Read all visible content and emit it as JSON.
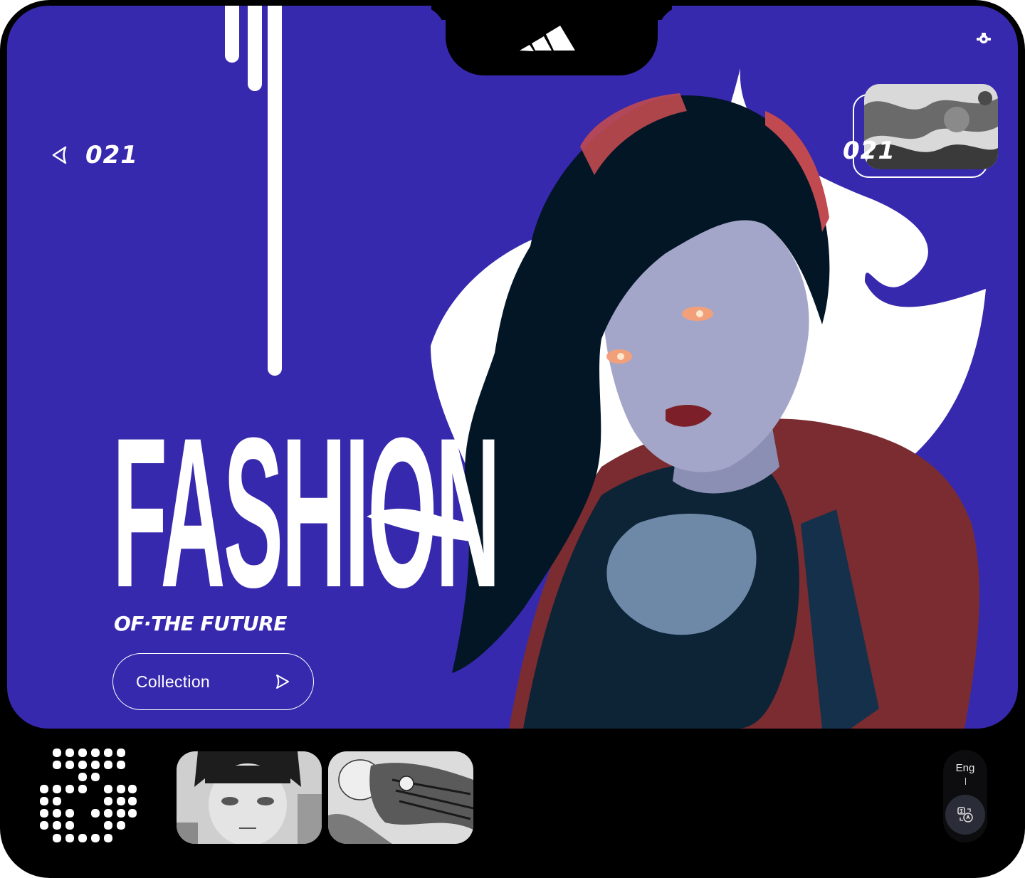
{
  "brand": {
    "logo_icon": "adidas-logo-icon"
  },
  "top_right": {
    "icon": "settings-icon"
  },
  "hero": {
    "counter": "021",
    "title": "FASHION",
    "subtitle": "OF·THE FUTURE",
    "cta_label": "Collection",
    "background_color": "#3729ae"
  },
  "preview": {
    "counter": "021"
  },
  "footer": {
    "logo_icon": "dot-matrix-logo-icon",
    "thumbnails": [
      {
        "name": "gallery-thumbnail-1"
      },
      {
        "name": "gallery-thumbnail-2"
      }
    ],
    "language": {
      "label": "Eng",
      "icon": "translate-icon"
    }
  }
}
